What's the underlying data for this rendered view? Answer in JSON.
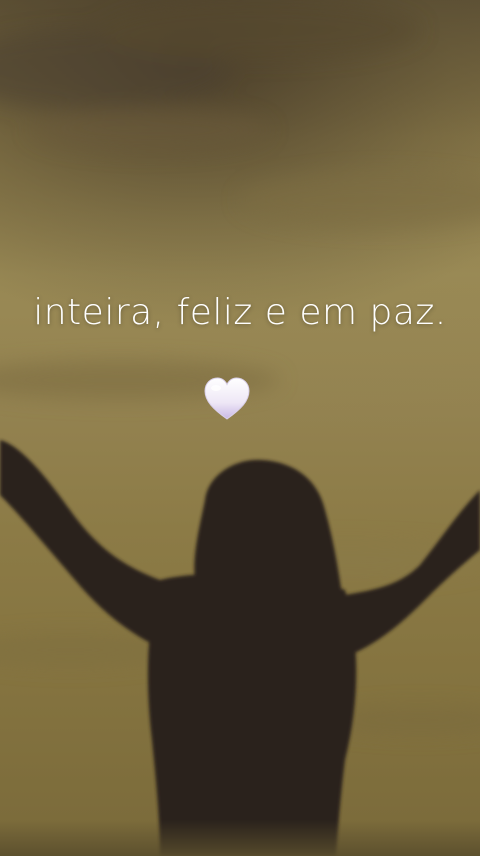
{
  "caption": {
    "text": "inteira, feliz e em paz."
  },
  "emoji": {
    "name": "white-heart-icon",
    "char": "🤍"
  },
  "colors": {
    "sky": "#938250",
    "sky_dark": "#5f5236",
    "silhouette": "#2a221c",
    "caption_text": "#ffffff",
    "heart_top": "#ffffff",
    "heart_bottom": "#c9b8e6"
  }
}
